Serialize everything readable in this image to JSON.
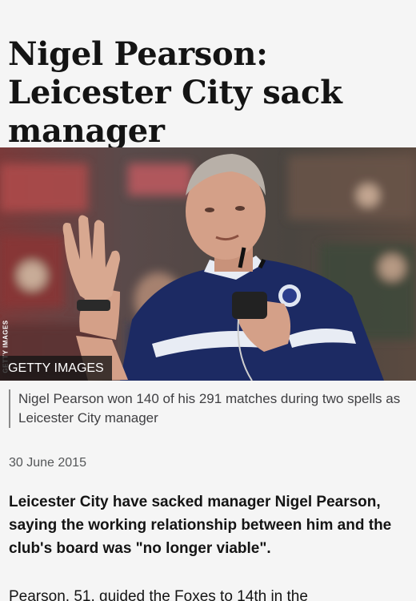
{
  "article": {
    "headline": "Nigel Pearson: Leicester City sack manager",
    "image_credit": "GETTY IMAGES",
    "image_side_credit": "GETTY IMAGES",
    "caption": "Nigel Pearson won 140 of his 291 matches during two spells as Leicester City manager",
    "date": "30 June 2015",
    "intro": "Leicester City have sacked manager Nigel Pearson, saying the working relationship between him and the club's board was \"no longer viable\".",
    "next_paragraph_partial": "Pearson, 51, guided the Foxes to 14th in the"
  },
  "colors": {
    "background": "#f5f5f5",
    "text": "#141414",
    "kit_navy": "#1c2a63"
  },
  "image": {
    "subject": "man in navy Leicester City training top waving and holding a headset"
  }
}
